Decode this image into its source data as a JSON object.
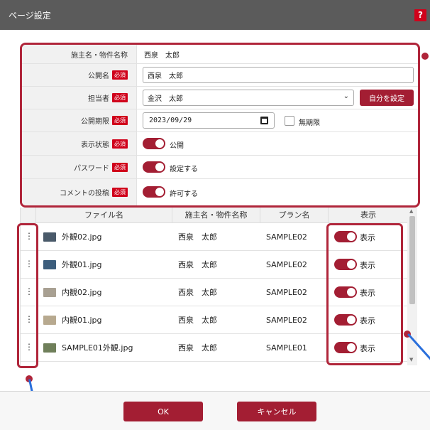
{
  "window": {
    "title": "ページ設定",
    "help_label": "?"
  },
  "form": {
    "required_badge": "必須",
    "rows": {
      "client_name": {
        "label": "施主名・物件名称",
        "value": "西泉　太郎"
      },
      "public_name": {
        "label": "公開名",
        "value": "西泉　太郎"
      },
      "person_in_charge": {
        "label": "担当者",
        "value": "金沢　太郎",
        "set_self_label": "自分を設定"
      },
      "expiry": {
        "label": "公開期限",
        "value": "2023/09/29",
        "no_limit_label": "無期限",
        "no_limit_checked": false
      },
      "display_state": {
        "label": "表示状態",
        "toggle_label": "公開",
        "on": true
      },
      "password": {
        "label": "パスワード",
        "toggle_label": "設定する",
        "on": true
      },
      "comment_post": {
        "label": "コメントの投稿",
        "toggle_label": "許可する",
        "on": true
      }
    }
  },
  "table": {
    "columns": [
      "ファイル名",
      "施主名・物件名称",
      "プラン名",
      "表示"
    ],
    "rows": [
      {
        "file": "外観02.jpg",
        "client": "西泉　太郎",
        "plan": "SAMPLE02",
        "display": "表示",
        "thumb_color": "#4a5a6a"
      },
      {
        "file": "外観01.jpg",
        "client": "西泉　太郎",
        "plan": "SAMPLE02",
        "display": "表示",
        "thumb_color": "#3c5d7c"
      },
      {
        "file": "内観02.jpg",
        "client": "西泉　太郎",
        "plan": "SAMPLE02",
        "display": "表示",
        "thumb_color": "#a8a092"
      },
      {
        "file": "内観01.jpg",
        "client": "西泉　太郎",
        "plan": "SAMPLE02",
        "display": "表示",
        "thumb_color": "#b7a98f"
      },
      {
        "file": "SAMPLE01外観.jpg",
        "client": "西泉　太郎",
        "plan": "SAMPLE01",
        "display": "表示",
        "thumb_color": "#6f7f5a"
      }
    ]
  },
  "footer": {
    "ok_label": "OK",
    "cancel_label": "キャンセル"
  },
  "colors": {
    "accent": "#a31e33",
    "highlight": "#b0253a",
    "callout_line": "#2a6fdb",
    "titlebar": "#5b5b5b"
  }
}
